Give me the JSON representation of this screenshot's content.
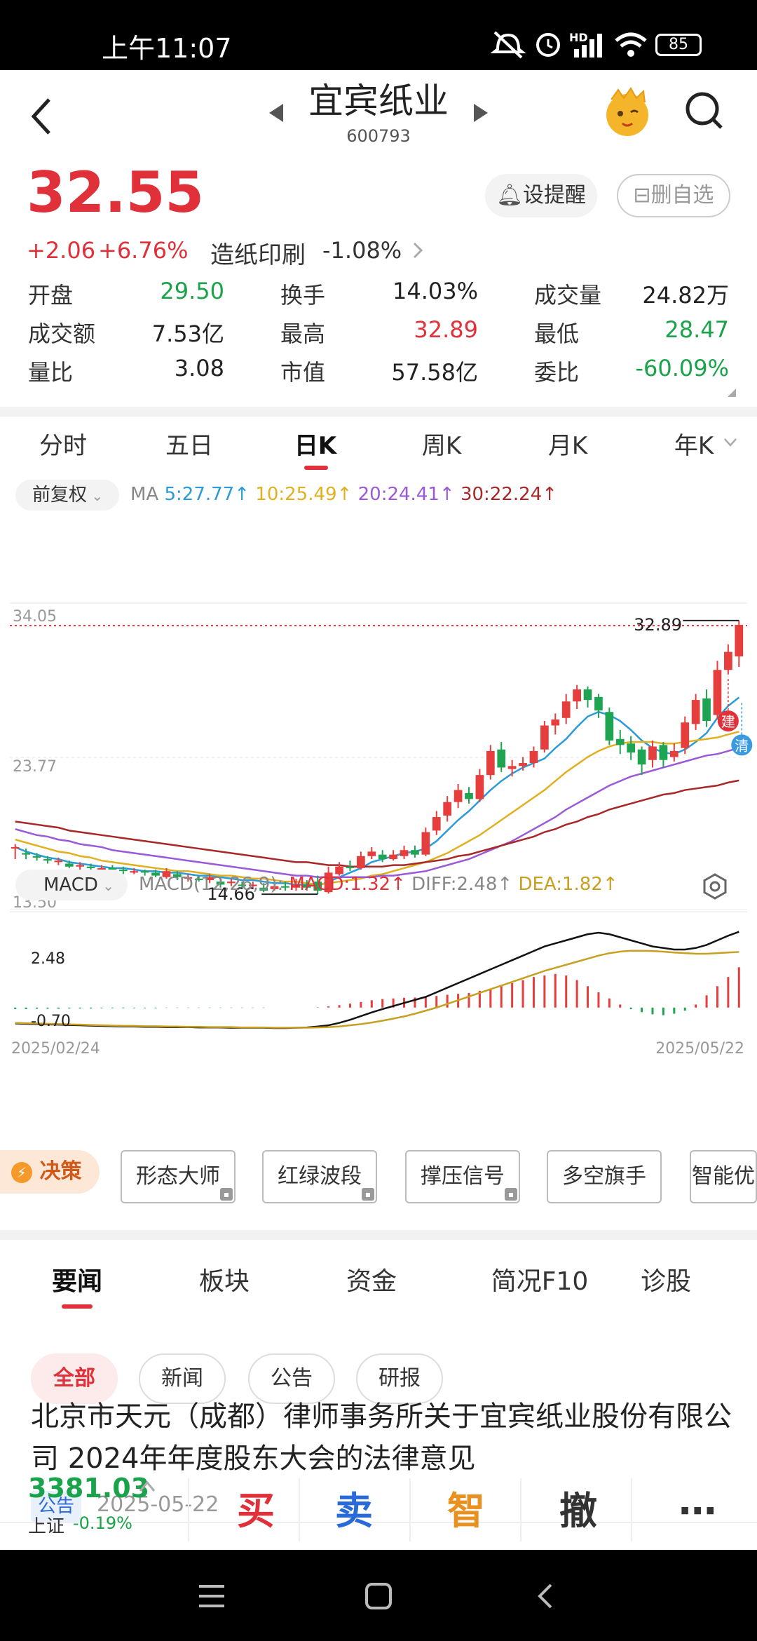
{
  "status_bar": {
    "time": "上午11:07",
    "battery": "85",
    "hd": "HD"
  },
  "header": {
    "stock_name": "宜宾纸业",
    "stock_code": "600793"
  },
  "quote": {
    "price": "32.55",
    "change": "+2.06",
    "change_pct": "+6.76%",
    "sector_name": "造纸印刷",
    "sector_change": "-1.08%",
    "set_alert_label": "设提醒",
    "remove_watch_label": "删自选",
    "stats": [
      {
        "label": "开盘",
        "value": "29.50",
        "color": "green"
      },
      {
        "label": "换手",
        "value": "14.03%",
        "color": "normal"
      },
      {
        "label": "成交量",
        "value": "24.82万",
        "color": "normal"
      },
      {
        "label": "成交额",
        "value": "7.53亿",
        "color": "normal"
      },
      {
        "label": "最高",
        "value": "32.89",
        "color": "red"
      },
      {
        "label": "最低",
        "value": "28.47",
        "color": "green"
      },
      {
        "label": "量比",
        "value": "3.08",
        "color": "normal"
      },
      {
        "label": "市值",
        "value": "57.58亿",
        "color": "normal"
      },
      {
        "label": "委比",
        "value": "-60.09%",
        "color": "green"
      }
    ]
  },
  "period_tabs": [
    "分时",
    "五日",
    "日K",
    "周K",
    "月K",
    "年K"
  ],
  "active_period": "日K",
  "ma_bar": {
    "adjust": "前复权",
    "prefix": "MA",
    "ma5": "5:27.77",
    "ma10": "10:25.49",
    "ma20": "20:24.41",
    "ma30": "30:22.24",
    "colors": {
      "ma5": "#2a9ad8",
      "ma10": "#e0b020",
      "ma20": "#9a5ad8",
      "ma30": "#a82828"
    }
  },
  "kline": {
    "y_labels": [
      "34.05",
      "23.77",
      "13.50"
    ],
    "high_label": "32.89",
    "low_label": "14.66",
    "marker_build": "建",
    "marker_clear": "清"
  },
  "macd_bar": {
    "name": "MACD",
    "params": "MACD(12,26,9):",
    "macd": "MACD:1.32",
    "diff": "DIFF:2.48",
    "dea": "DEA:1.82",
    "y_top": "2.48",
    "y_bottom": "-0.70",
    "date_start": "2025/02/24",
    "date_end": "2025/05/22"
  },
  "tools": {
    "decision_label": "决策",
    "buttons": [
      "形态大师",
      "红绿波段",
      "撑压信号",
      "多空旗手",
      "智能优"
    ]
  },
  "content_tabs": [
    "要闻",
    "板块",
    "资金",
    "简况F10",
    "诊股"
  ],
  "active_content_tab": "要闻",
  "filter_tabs": [
    "全部",
    "新闻",
    "公告",
    "研报"
  ],
  "news": [
    {
      "title": "北京市天元（成都）律师事务所关于宜宾纸业股份有限公司 2024年年度股东大会的法律意见",
      "tag": "公告",
      "date": "2025-05-22"
    }
  ],
  "bottom": {
    "index_value": "3381.03",
    "index_name": "上证",
    "index_change": "-0.19%",
    "buy": "买",
    "sell": "卖",
    "smart": "智",
    "cancel": "撤",
    "more": "⋯"
  },
  "chart_data": [
    {
      "type": "candlestick",
      "title": "日K",
      "x_start": "2025/02/24",
      "x_end": "2025/05/22",
      "ylim": [
        13.5,
        34.05
      ],
      "y_ticks": [
        34.05,
        23.77,
        13.5
      ],
      "candles": [
        [
          17.7,
          17.8,
          18.0,
          17.0
        ],
        [
          17.4,
          17.3,
          17.7,
          17.0
        ],
        [
          17.2,
          17.1,
          17.4,
          16.9
        ],
        [
          17.0,
          16.9,
          17.2,
          16.7
        ],
        [
          16.8,
          16.9,
          17.1,
          16.6
        ],
        [
          16.7,
          16.5,
          16.9,
          16.4
        ],
        [
          16.5,
          16.6,
          16.8,
          16.3
        ],
        [
          16.5,
          16.4,
          16.7,
          16.2
        ],
        [
          16.3,
          16.4,
          16.6,
          16.2
        ],
        [
          16.4,
          16.3,
          16.6,
          16.1
        ],
        [
          16.3,
          16.2,
          16.5,
          16.0
        ],
        [
          16.1,
          16.2,
          16.4,
          16.0
        ],
        [
          16.2,
          16.1,
          16.3,
          15.9
        ],
        [
          16.1,
          15.9,
          16.3,
          15.8
        ],
        [
          15.8,
          16.2,
          16.4,
          15.7
        ],
        [
          16.0,
          15.8,
          16.2,
          15.6
        ],
        [
          15.7,
          15.8,
          16.0,
          15.5
        ],
        [
          15.7,
          15.6,
          15.9,
          15.5
        ],
        [
          15.6,
          15.8,
          16.0,
          15.4
        ],
        [
          15.5,
          15.3,
          15.8,
          15.1
        ],
        [
          15.4,
          15.5,
          15.7,
          15.2
        ],
        [
          15.3,
          15.2,
          15.5,
          15.0
        ],
        [
          15.2,
          15.3,
          15.5,
          15.0
        ],
        [
          15.1,
          14.9,
          15.4,
          14.8
        ],
        [
          15.0,
          15.2,
          15.6,
          14.9
        ],
        [
          15.2,
          15.1,
          15.5,
          14.9
        ],
        [
          15.1,
          15.3,
          15.7,
          14.9
        ],
        [
          15.3,
          15.1,
          15.6,
          14.9
        ],
        [
          15.5,
          14.9,
          15.9,
          14.66
        ],
        [
          14.8,
          16.1,
          16.5,
          14.7
        ],
        [
          16.0,
          16.5,
          16.8,
          15.9
        ],
        [
          16.5,
          16.4,
          16.9,
          16.2
        ],
        [
          16.4,
          17.2,
          17.5,
          16.3
        ],
        [
          17.2,
          17.5,
          17.8,
          17.0
        ],
        [
          17.3,
          17.0,
          17.6,
          16.8
        ],
        [
          17.0,
          17.3,
          17.6,
          16.9
        ],
        [
          17.2,
          17.6,
          17.9,
          17.0
        ],
        [
          17.6,
          17.3,
          17.9,
          17.1
        ],
        [
          17.3,
          18.8,
          19.1,
          17.2
        ],
        [
          18.9,
          19.8,
          20.2,
          18.6
        ],
        [
          19.9,
          20.8,
          21.2,
          19.5
        ],
        [
          20.8,
          21.6,
          22.0,
          20.4
        ],
        [
          21.4,
          21.0,
          21.8,
          20.7
        ],
        [
          21.0,
          22.6,
          23.0,
          20.8
        ],
        [
          22.6,
          24.2,
          24.6,
          22.3
        ],
        [
          24.3,
          23.1,
          24.8,
          22.8
        ],
        [
          23.0,
          23.2,
          23.6,
          22.5
        ],
        [
          23.2,
          23.4,
          23.8,
          22.9
        ],
        [
          23.4,
          24.2,
          24.5,
          23.1
        ],
        [
          24.3,
          25.9,
          26.2,
          24.1
        ],
        [
          25.9,
          26.3,
          26.7,
          25.3
        ],
        [
          26.4,
          27.5,
          28.0,
          26.0
        ],
        [
          27.5,
          28.3,
          28.6,
          27.0
        ],
        [
          28.3,
          27.6,
          28.5,
          27.1
        ],
        [
          27.8,
          26.9,
          28.0,
          26.4
        ],
        [
          26.8,
          24.9,
          27.1,
          24.6
        ],
        [
          25.0,
          24.6,
          25.6,
          24.0
        ],
        [
          24.7,
          24.1,
          25.2,
          23.6
        ],
        [
          24.3,
          23.3,
          24.5,
          22.6
        ],
        [
          23.6,
          24.5,
          24.9,
          23.1
        ],
        [
          24.6,
          23.6,
          24.8,
          23.1
        ],
        [
          23.8,
          24.2,
          24.7,
          23.5
        ],
        [
          24.4,
          26.1,
          26.5,
          24.0
        ],
        [
          26.0,
          27.6,
          28.0,
          25.6
        ],
        [
          27.7,
          26.2,
          28.3,
          25.8
        ],
        [
          26.6,
          29.6,
          30.2,
          26.3
        ],
        [
          29.6,
          30.8,
          31.3,
          29.3
        ],
        [
          30.5,
          32.6,
          32.89,
          29.8
        ]
      ],
      "ma_lines": {
        "MA5": [
          17.8,
          17.5,
          17.3,
          17.1,
          17.0,
          16.8,
          16.7,
          16.6,
          16.5,
          16.4,
          16.4,
          16.3,
          16.2,
          16.2,
          16.1,
          16.1,
          16.0,
          15.9,
          15.9,
          15.8,
          15.7,
          15.6,
          15.6,
          15.5,
          15.4,
          15.4,
          15.3,
          15.3,
          15.2,
          15.5,
          15.8,
          16.1,
          16.4,
          16.8,
          17.0,
          17.2,
          17.4,
          17.5,
          17.7,
          18.2,
          18.9,
          19.6,
          20.2,
          20.9,
          21.6,
          22.2,
          22.7,
          23.1,
          23.4,
          23.7,
          24.4,
          25.0,
          25.8,
          26.5,
          26.8,
          26.6,
          26.2,
          25.6,
          24.9,
          24.4,
          24.1,
          24.0,
          24.3,
          24.8,
          25.4,
          26.4,
          27.2,
          27.77
        ],
        "MA10": [
          18.3,
          18.1,
          17.9,
          17.7,
          17.5,
          17.4,
          17.2,
          17.1,
          16.9,
          16.8,
          16.7,
          16.6,
          16.5,
          16.4,
          16.3,
          16.2,
          16.2,
          16.1,
          16.0,
          15.9,
          15.9,
          15.8,
          15.7,
          15.7,
          15.6,
          15.5,
          15.5,
          15.4,
          15.3,
          15.4,
          15.5,
          15.6,
          15.7,
          15.9,
          16.0,
          16.2,
          16.4,
          16.6,
          16.8,
          17.1,
          17.4,
          17.8,
          18.2,
          18.6,
          19.1,
          19.6,
          20.1,
          20.6,
          21.1,
          21.6,
          22.2,
          22.8,
          23.3,
          23.8,
          24.2,
          24.5,
          24.7,
          24.8,
          24.8,
          24.8,
          24.7,
          24.7,
          24.8,
          24.9,
          25.0,
          25.1,
          25.3,
          25.49
        ],
        "MA20": [
          19.0,
          18.8,
          18.6,
          18.5,
          18.3,
          18.2,
          18.0,
          17.9,
          17.8,
          17.6,
          17.5,
          17.4,
          17.3,
          17.2,
          17.1,
          17.0,
          16.9,
          16.8,
          16.7,
          16.6,
          16.5,
          16.4,
          16.3,
          16.2,
          16.1,
          16.0,
          15.9,
          15.9,
          15.8,
          15.8,
          15.8,
          15.8,
          15.8,
          15.8,
          15.9,
          15.9,
          16.0,
          16.1,
          16.2,
          16.4,
          16.6,
          16.8,
          17.0,
          17.3,
          17.6,
          17.9,
          18.2,
          18.6,
          19.0,
          19.4,
          19.8,
          20.3,
          20.7,
          21.1,
          21.5,
          21.9,
          22.2,
          22.5,
          22.7,
          22.9,
          23.1,
          23.3,
          23.5,
          23.7,
          23.9,
          24.0,
          24.2,
          24.41
        ],
        "MA30": [
          19.5,
          19.4,
          19.3,
          19.2,
          19.1,
          18.9,
          18.8,
          18.7,
          18.6,
          18.5,
          18.4,
          18.3,
          18.2,
          18.1,
          18.0,
          17.9,
          17.8,
          17.7,
          17.6,
          17.5,
          17.4,
          17.3,
          17.2,
          17.1,
          17.0,
          16.9,
          16.8,
          16.8,
          16.7,
          16.6,
          16.6,
          16.5,
          16.5,
          16.5,
          16.5,
          16.6,
          16.6,
          16.7,
          16.8,
          16.9,
          17.0,
          17.2,
          17.3,
          17.5,
          17.7,
          17.9,
          18.1,
          18.3,
          18.5,
          18.8,
          19.0,
          19.3,
          19.5,
          19.8,
          20.0,
          20.3,
          20.5,
          20.7,
          20.9,
          21.1,
          21.3,
          21.4,
          21.6,
          21.7,
          21.8,
          21.9,
          22.1,
          22.24
        ]
      }
    },
    {
      "type": "bar",
      "title": "MACD(12,26,9)",
      "x_start": "2025/02/24",
      "x_end": "2025/05/22",
      "ylim": [
        -0.9,
        3.0
      ],
      "series": [
        {
          "name": "MACD",
          "values": [
            -0.05,
            -0.05,
            -0.04,
            -0.04,
            -0.04,
            -0.03,
            -0.03,
            -0.03,
            -0.02,
            -0.02,
            -0.02,
            -0.02,
            -0.02,
            -0.02,
            -0.01,
            -0.01,
            -0.01,
            -0.01,
            -0.01,
            -0.01,
            -0.01,
            -0.01,
            -0.01,
            -0.01,
            0.0,
            0.0,
            0.0,
            0.0,
            0.01,
            0.04,
            0.08,
            0.13,
            0.18,
            0.24,
            0.28,
            0.3,
            0.32,
            0.33,
            0.35,
            0.38,
            0.42,
            0.45,
            0.48,
            0.55,
            0.62,
            0.7,
            0.8,
            0.9,
            1.0,
            1.05,
            1.1,
            1.05,
            0.9,
            0.7,
            0.5,
            0.3,
            0.1,
            -0.05,
            -0.15,
            -0.22,
            -0.25,
            -0.2,
            -0.1,
            0.1,
            0.4,
            0.7,
            1.0,
            1.32
          ]
        },
        {
          "name": "DIFF",
          "values": [
            -0.52,
            -0.53,
            -0.54,
            -0.55,
            -0.56,
            -0.57,
            -0.58,
            -0.59,
            -0.6,
            -0.61,
            -0.62,
            -0.62,
            -0.63,
            -0.63,
            -0.64,
            -0.64,
            -0.64,
            -0.65,
            -0.65,
            -0.65,
            -0.66,
            -0.66,
            -0.66,
            -0.66,
            -0.67,
            -0.67,
            -0.66,
            -0.65,
            -0.62,
            -0.58,
            -0.5,
            -0.4,
            -0.28,
            -0.16,
            -0.05,
            0.05,
            0.15,
            0.25,
            0.35,
            0.5,
            0.65,
            0.8,
            0.95,
            1.1,
            1.25,
            1.4,
            1.55,
            1.7,
            1.85,
            2.0,
            2.1,
            2.2,
            2.3,
            2.4,
            2.45,
            2.4,
            2.3,
            2.2,
            2.1,
            2.0,
            1.95,
            1.9,
            1.9,
            1.95,
            2.05,
            2.2,
            2.35,
            2.48
          ]
        },
        {
          "name": "DEA",
          "values": [
            -0.5,
            -0.51,
            -0.52,
            -0.53,
            -0.54,
            -0.55,
            -0.56,
            -0.57,
            -0.58,
            -0.59,
            -0.6,
            -0.6,
            -0.61,
            -0.61,
            -0.62,
            -0.62,
            -0.63,
            -0.63,
            -0.64,
            -0.64,
            -0.64,
            -0.65,
            -0.65,
            -0.65,
            -0.66,
            -0.66,
            -0.66,
            -0.66,
            -0.65,
            -0.64,
            -0.62,
            -0.58,
            -0.54,
            -0.49,
            -0.43,
            -0.36,
            -0.29,
            -0.2,
            -0.1,
            0.0,
            0.12,
            0.24,
            0.36,
            0.48,
            0.6,
            0.72,
            0.84,
            0.96,
            1.08,
            1.2,
            1.3,
            1.4,
            1.5,
            1.6,
            1.7,
            1.78,
            1.83,
            1.86,
            1.86,
            1.85,
            1.83,
            1.8,
            1.78,
            1.76,
            1.76,
            1.78,
            1.8,
            1.82
          ]
        }
      ]
    }
  ]
}
